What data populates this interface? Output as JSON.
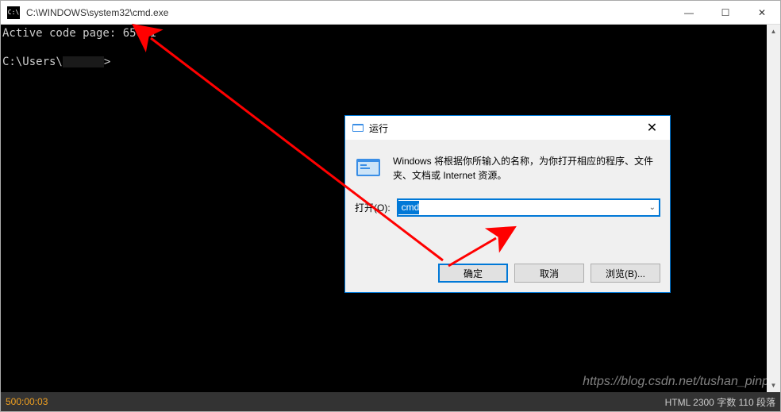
{
  "cmd": {
    "title": "C:\\WINDOWS\\system32\\cmd.exe",
    "line1": "Active code page: 65001",
    "promptPrefix": "C:\\Users\\",
    "promptSuffix": ">"
  },
  "run": {
    "title": "运行",
    "description": "Windows 将根据你所输入的名称，为你打开相应的程序、文件夹、文档或 Internet 资源。",
    "openLabel": "打开(O):",
    "inputValue": "cmd",
    "okLabel": "确定",
    "cancelLabel": "取消",
    "browseLabel": "浏览(B)..."
  },
  "status": {
    "left": "500:00:03",
    "right": "HTML   2300 字数  110 段落"
  },
  "watermark": "https://blog.csdn.net/tushan_pinp",
  "controls": {
    "minimize": "—",
    "maximize": "☐",
    "close": "✕"
  }
}
